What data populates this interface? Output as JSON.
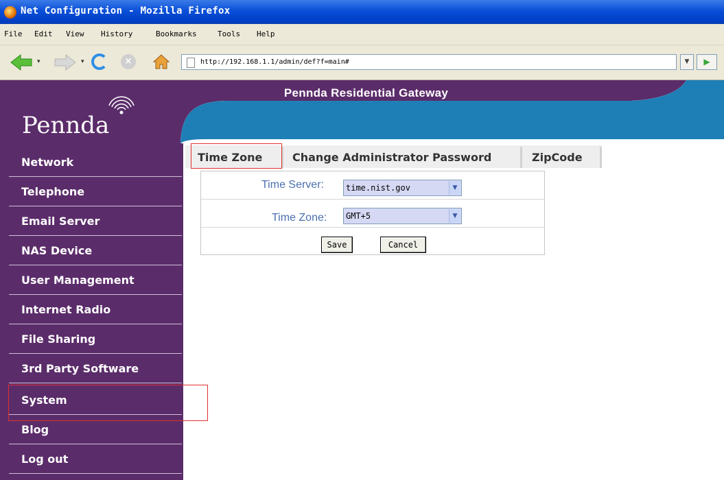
{
  "window": {
    "title": "Net Configuration - Mozilla Firefox"
  },
  "menu": [
    "File",
    "Edit",
    "View",
    "History",
    "Bookmarks",
    "Tools",
    "Help"
  ],
  "toolbar": {
    "url": "http://192.168.1.1/admin/def?f=main#"
  },
  "header": {
    "title": "Pennda Residential Gateway",
    "logo": "Pennda"
  },
  "sidebar": {
    "items": [
      {
        "label": "Network"
      },
      {
        "label": "Telephone"
      },
      {
        "label": "Email Server"
      },
      {
        "label": "NAS Device"
      },
      {
        "label": "User Management"
      },
      {
        "label": "Internet Radio"
      },
      {
        "label": "File Sharing"
      },
      {
        "label": "3rd Party Software"
      },
      {
        "label": "System"
      },
      {
        "label": "Blog"
      },
      {
        "label": "Log out"
      }
    ]
  },
  "tabs": [
    {
      "label": "Time Zone"
    },
    {
      "label": "Change Administrator Password"
    },
    {
      "label": "ZipCode"
    }
  ],
  "form": {
    "time_server_label": "Time Server:",
    "time_server_value": "time.nist.gov",
    "time_zone_label": "Time Zone:",
    "time_zone_value": "GMT+5",
    "save_label": "Save",
    "cancel_label": "Cancel"
  },
  "colors": {
    "sidebar": "#5b2c6a",
    "accent_highlight": "#e0312f",
    "header_blue": "#1e7fb6"
  }
}
